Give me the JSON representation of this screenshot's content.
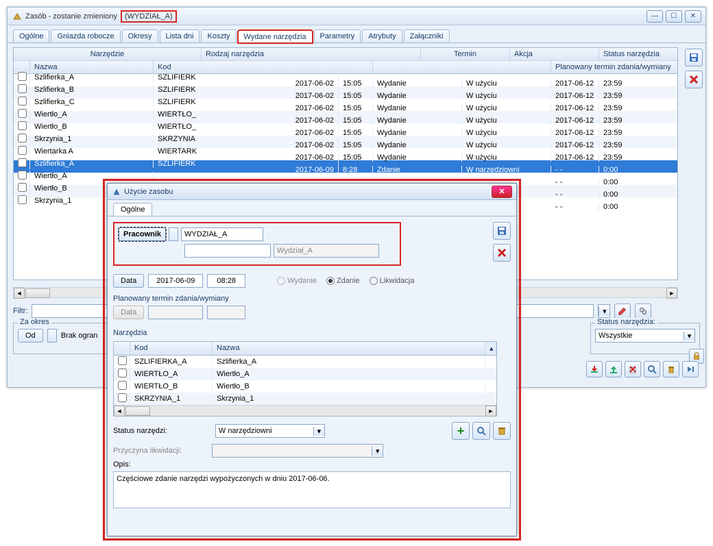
{
  "window": {
    "title_prefix": "Zasób - zostanie zmieniony ",
    "title_highlight": "(WYDZIAŁ_A)"
  },
  "tabs": [
    "Ogólne",
    "Gniazda robocze",
    "Okresy",
    "Lista dni",
    "Koszty",
    "Wydane narzędzia",
    "Parametry",
    "Atrybuty",
    "Załączniki"
  ],
  "table": {
    "group_header": "Narzędzie",
    "headers": {
      "nazwa": "Nazwa",
      "kod": "Kod",
      "rodzaj": "Rodzaj narzędzia",
      "termin": "Termin",
      "akcja": "Akcja",
      "status": "Status narzędzia",
      "plan": "Planowany termin zdania/wymiany"
    },
    "rows": [
      {
        "nazwa": "Szlifierka_A",
        "kod": "SZLIFIERK",
        "date": "2017-06-02",
        "time": "15:05",
        "akcja": "Wydanie",
        "status": "W użyciu",
        "plan_d": "2017-06-12",
        "plan_t": "23:59",
        "sel": false
      },
      {
        "nazwa": "Szlifierka_B",
        "kod": "SZLIFIERK",
        "date": "2017-06-02",
        "time": "15:05",
        "akcja": "Wydanie",
        "status": "W użyciu",
        "plan_d": "2017-06-12",
        "plan_t": "23:59",
        "sel": false
      },
      {
        "nazwa": "Szlifierka_C",
        "kod": "SZLIFIERK",
        "date": "2017-06-02",
        "time": "15:05",
        "akcja": "Wydanie",
        "status": "W użyciu",
        "plan_d": "2017-06-12",
        "plan_t": "23:59",
        "sel": false
      },
      {
        "nazwa": "Wiertło_A",
        "kod": "WIERTŁO_",
        "date": "2017-06-02",
        "time": "15:05",
        "akcja": "Wydanie",
        "status": "W użyciu",
        "plan_d": "2017-06-12",
        "plan_t": "23:59",
        "sel": false
      },
      {
        "nazwa": "Wiertło_B",
        "kod": "WIERTŁO_",
        "date": "2017-06-02",
        "time": "15:05",
        "akcja": "Wydanie",
        "status": "W użyciu",
        "plan_d": "2017-06-12",
        "plan_t": "23:59",
        "sel": false
      },
      {
        "nazwa": "Skrzynia_1",
        "kod": "SKRZYNIA",
        "date": "2017-06-02",
        "time": "15:05",
        "akcja": "Wydanie",
        "status": "W użyciu",
        "plan_d": "2017-06-12",
        "plan_t": "23:59",
        "sel": false
      },
      {
        "nazwa": "Wiertarka A",
        "kod": "WIERTARK",
        "date": "2017-06-02",
        "time": "15:05",
        "akcja": "Wydanie",
        "status": "W użyciu",
        "plan_d": "2017-06-12",
        "plan_t": "23:59",
        "sel": false
      },
      {
        "nazwa": "Szlifierka_A",
        "kod": "SZLIFIERK",
        "date": "2017-06-09",
        "time": "8:28",
        "akcja": "Zdanie",
        "status": "W narzędziowni",
        "plan_d": " -  - ",
        "plan_t": "0:00",
        "sel": true
      },
      {
        "nazwa": "Wiertło_A",
        "kod": "",
        "date": "",
        "time": "",
        "akcja": "",
        "status": "",
        "plan_d": " -  - ",
        "plan_t": "0:00",
        "sel": false
      },
      {
        "nazwa": "Wiertło_B",
        "kod": "",
        "date": "",
        "time": "",
        "akcja": "",
        "status": "",
        "plan_d": " -  - ",
        "plan_t": "0:00",
        "sel": false
      },
      {
        "nazwa": "Skrzynia_1",
        "kod": "",
        "date": "",
        "time": "",
        "akcja": "",
        "status": "",
        "plan_d": " -  - ",
        "plan_t": "0:00",
        "sel": false
      }
    ]
  },
  "filter_label": "Filtr:",
  "period": {
    "legend": "Za okres",
    "btn": "Od",
    "text": "Brak ogran"
  },
  "status_filter": {
    "legend": "Status narzędzia:",
    "value": "Wszystkie"
  },
  "dialog": {
    "title": "Użycie zasobu",
    "tab": "Ogólne",
    "pracownik_btn": "Pracownik",
    "pracownik_value": "WYDZIAŁ_A",
    "pracownik_name": "Wydział_A",
    "data_btn": "Data",
    "date": "2017-06-09",
    "time": "08:28",
    "radios": {
      "wydanie": "Wydanie",
      "zdanie": "Zdanie",
      "likwidacja": "Likwidacja"
    },
    "plan_label": "Planowany termin zdania/wymiany",
    "plan_btn": "Data",
    "tools_label": "Narzędzia",
    "tools_headers": {
      "kod": "Kod",
      "nazwa": "Nazwa"
    },
    "tools": [
      {
        "kod": "SZLIFIERKA_A",
        "nazwa": "Szlifierka_A"
      },
      {
        "kod": "WIERTŁO_A",
        "nazwa": "Wiertło_A"
      },
      {
        "kod": "WIERTŁO_B",
        "nazwa": "Wiertło_B"
      },
      {
        "kod": "SKRZYNIA_1",
        "nazwa": "Skrzynia_1"
      }
    ],
    "status_label": "Status narzędzi:",
    "status_value": "W narzędziowni",
    "przyczyna_label": "Przyczyna likwidacji:",
    "opis_label": "Opis:",
    "opis_text": "Częściowe zdanie narzędzi wypożyczonych w dniu 2017-06-06."
  }
}
